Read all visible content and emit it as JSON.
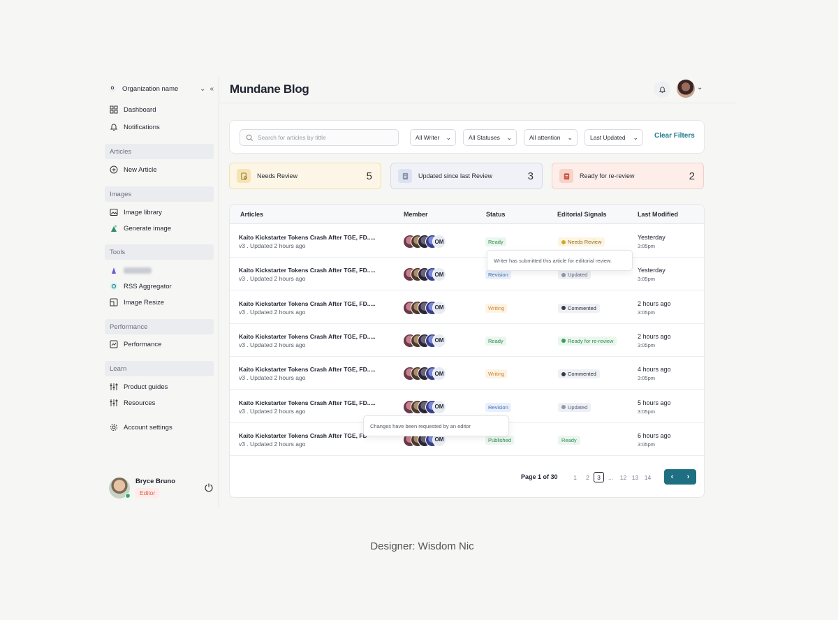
{
  "org": {
    "initial": "O",
    "name": "Organization name",
    "chevron": "⌄",
    "collapse": "«"
  },
  "sidebar": {
    "dashboard": "Dashboard",
    "notifications": "Notifications",
    "sections": {
      "articles": "Articles",
      "images": "Images",
      "tools": "Tools",
      "performance": "Performance",
      "learn": "Learn"
    },
    "new_article": "New Article",
    "image_library": "Image library",
    "generate_image": "Generate image",
    "rss_aggregator": "RSS Aggregator",
    "image_resize": "Image Resize",
    "performance": "Performance",
    "product_guides": "Product guides",
    "resources": "Resources",
    "account_settings": "Account settings"
  },
  "user": {
    "name": "Bryce Bruno",
    "role": "Editor"
  },
  "header": {
    "title": "Mundane Blog"
  },
  "filters": {
    "search_placeholder": "Search for articles by tittle",
    "writer": "All Writer",
    "statuses": "All Statuses",
    "attention": "All attention",
    "sort": "Last Updated",
    "clear": "Clear Filters"
  },
  "stats": [
    {
      "label": "Needs Review",
      "value": "5"
    },
    {
      "label": "Updated since last Review",
      "value": "3"
    },
    {
      "label": "Ready for re-review",
      "value": "2"
    }
  ],
  "table": {
    "columns": [
      "Articles",
      "Member",
      "Status",
      "Editorial Signals",
      "Last Modified"
    ],
    "member_initials": "OM",
    "rows": [
      {
        "title": "Kaito Kickstarter Tokens Crash After TGE, FD.....",
        "sub": "v3 . Updated 2 hours ago",
        "status": "Ready",
        "signal": "Needs Review",
        "modified": "Yesterday",
        "time": "3:05pm"
      },
      {
        "title": "Kaito Kickstarter Tokens Crash After TGE, FD.....",
        "sub": "v3 . Updated 2 hours ago",
        "status": "Revision",
        "signal": "Updated",
        "modified": "Yesterday",
        "time": "3:05pm"
      },
      {
        "title": "Kaito Kickstarter Tokens Crash After TGE, FD.....",
        "sub": "v3 . Updated 2 hours ago",
        "status": "Writing",
        "signal": "Commented",
        "modified": "2 hours ago",
        "time": "3:05pm"
      },
      {
        "title": "Kaito Kickstarter Tokens Crash After TGE, FD.....",
        "sub": "v3 . Updated 2 hours ago",
        "status": "Ready",
        "signal": "Ready for re-review",
        "modified": "2 hours ago",
        "time": "3:05pm"
      },
      {
        "title": "Kaito Kickstarter Tokens Crash After TGE, FD.....",
        "sub": "v3 . Updated 2 hours ago",
        "status": "Writing",
        "signal": "Commented",
        "modified": "4 hours ago",
        "time": "3:05pm"
      },
      {
        "title": "Kaito Kickstarter Tokens Crash After TGE, FD.....",
        "sub": "v3 . Updated 2 hours ago",
        "status": "Revision",
        "signal": "Updated",
        "modified": "5 hours ago",
        "time": "3:05pm"
      },
      {
        "title": "Kaito Kickstarter Tokens Crash After TGE, FD",
        "sub": "v3 . Updated 2 hours ago",
        "status": "Published",
        "signal": "Ready",
        "modified": "6 hours ago",
        "time": "3:05pm"
      }
    ]
  },
  "tooltips": {
    "needs_review": "Writer has submitted this article for editorial review.",
    "revision": "Changes have been requested by an editor"
  },
  "pagination": {
    "label": "Page 1 of 30",
    "pages": [
      "1",
      "2",
      "3",
      "...",
      "12",
      "13",
      "14"
    ],
    "prev": "‹",
    "next": "›"
  },
  "credit": "Designer: Wisdom Nic",
  "colors": {
    "accent": "#1e6f82",
    "clear_filters": "#1f7a8c"
  }
}
